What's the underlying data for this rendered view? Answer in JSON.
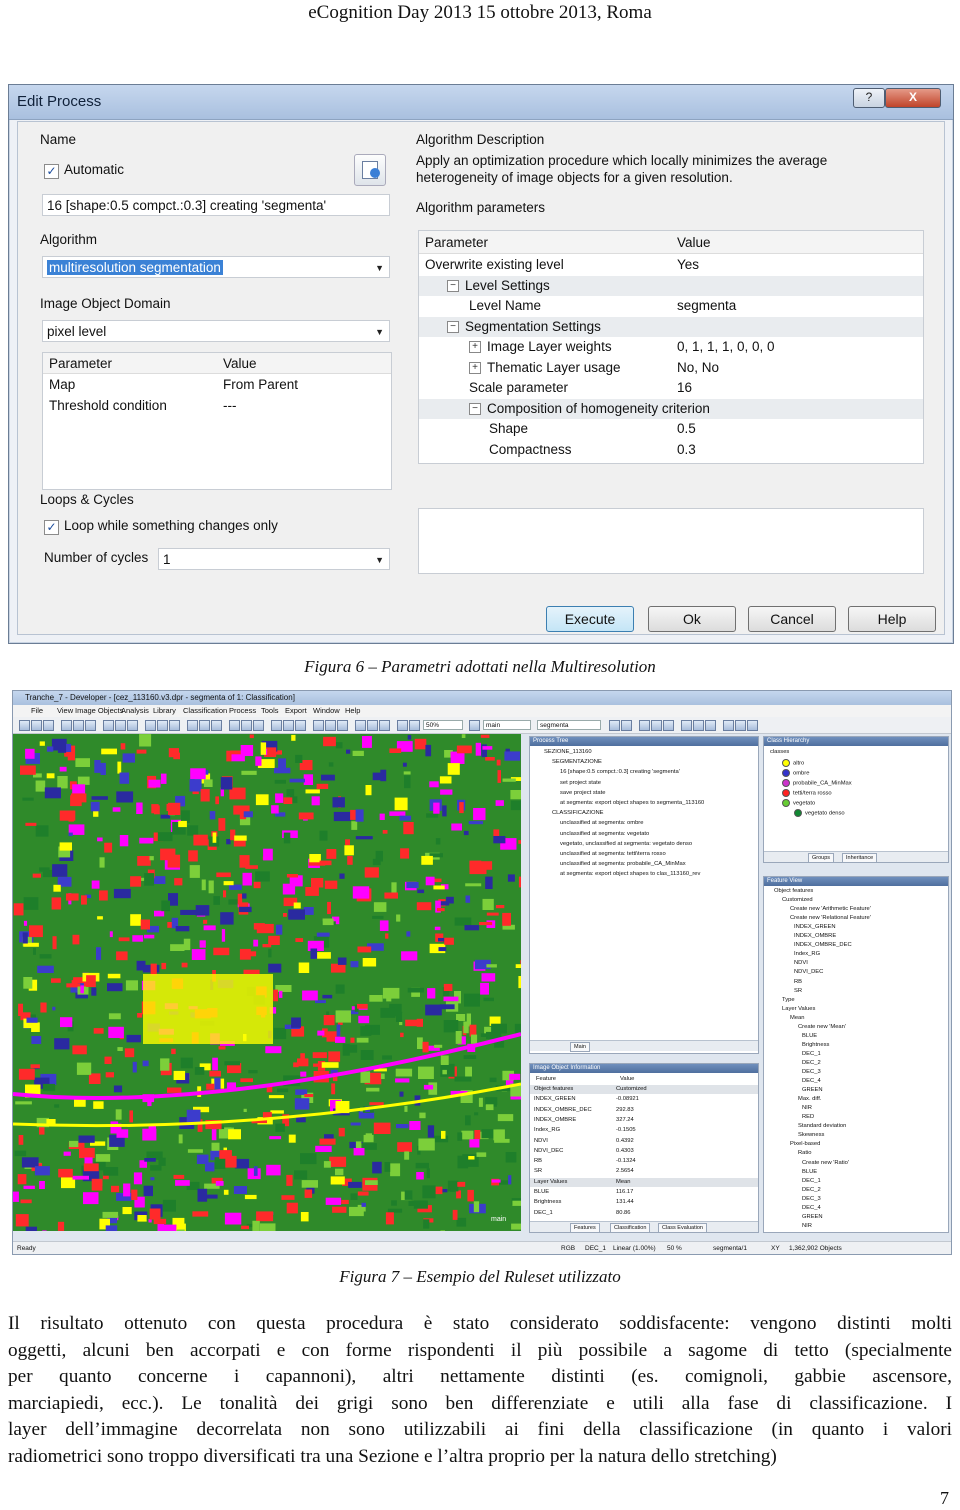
{
  "header": "eCognition Day 2013   15  ottobre 2013, Roma",
  "dialog": {
    "title": "Edit Process",
    "help_btn": "?",
    "close_btn": "X",
    "name_label": "Name",
    "automatic_label": "Automatic",
    "automatic_checked": true,
    "name_value": "16 [shape:0.5 compct.:0.3] creating 'segmenta'",
    "algorithm_label": "Algorithm",
    "algorithm_value": "multiresolution segmentation",
    "domain_label": "Image Object Domain",
    "domain_value": "pixel level",
    "domain_grid": {
      "headers": [
        "Parameter",
        "Value"
      ],
      "rows": [
        [
          "Map",
          "From Parent"
        ],
        [
          "Threshold condition",
          "---"
        ]
      ]
    },
    "loops_label": "Loops & Cycles",
    "loop_label": "Loop while something changes only",
    "loop_checked": true,
    "cycles_label": "Number of cycles",
    "cycles_value": "1",
    "desc_label": "Algorithm Description",
    "desc_text": "Apply an optimization procedure which locally minimizes the average heterogeneity of image objects for a given resolution.",
    "params_label": "Algorithm parameters",
    "params_headers": [
      "Parameter",
      "Value"
    ],
    "params": [
      {
        "name": "Overwrite existing level",
        "value": "Yes",
        "indent": 0,
        "exp": ""
      },
      {
        "name": "Level Settings",
        "value": "",
        "indent": 1,
        "exp": "−",
        "group": true
      },
      {
        "name": "Level Name",
        "value": "segmenta",
        "indent": 2,
        "exp": ""
      },
      {
        "name": "Segmentation Settings",
        "value": "",
        "indent": 1,
        "exp": "−",
        "group": true
      },
      {
        "name": "Image Layer weights",
        "value": "0, 1, 1, 1, 0, 0, 0",
        "indent": 2,
        "exp": "+"
      },
      {
        "name": "Thematic Layer usage",
        "value": "No, No",
        "indent": 2,
        "exp": "+"
      },
      {
        "name": "Scale parameter",
        "value": "16",
        "indent": 2,
        "exp": ""
      },
      {
        "name": "Composition of homogeneity criterion",
        "value": "",
        "indent": 2,
        "exp": "−",
        "group": true
      },
      {
        "name": "Shape",
        "value": "0.5",
        "indent": 3,
        "exp": ""
      },
      {
        "name": "Compactness",
        "value": "0.3",
        "indent": 3,
        "exp": ""
      }
    ],
    "buttons": {
      "execute": "Execute",
      "ok": "Ok",
      "cancel": "Cancel",
      "help": "Help"
    }
  },
  "caption6": "Figura 6 – Parametri adottati nella Multiresolution",
  "app": {
    "title": "Tranche_7 - Developer - [cez_113160.v3.dpr - segmenta of 1: Classification]",
    "menu": [
      "File",
      "View",
      "Image Objects",
      "Analysis",
      "Library",
      "Classification",
      "Process",
      "Tools",
      "Export",
      "Window",
      "Help"
    ],
    "zoom": "50%",
    "map_select": "main",
    "level_select": "segmenta",
    "map_label": "main",
    "process_tree": {
      "title": "Process Tree",
      "lines": [
        "SEZIONE_113160",
        "SEGMENTAZIONE",
        "16 [shape:0.5 compct.:0.3] creating 'segmenta'",
        "set project state",
        "save project state",
        "at segmenta: export object shapes to segmenta_113160",
        "CLASSIFICAZIONE",
        "unclassified at segmenta: ombre",
        "unclassified at segmenta: vegetato",
        "vegetato, unclassified at segmenta: vegetato denso",
        "unclassified at segmenta: tetti\\terra rosso",
        "unclassified at segmenta: probabile_CA_MinMax",
        "at segmenta: export object shapes to clas_113160_rev"
      ],
      "tab": "Main"
    },
    "class_hierarchy": {
      "title": "Class Hierarchy",
      "root": "classes",
      "items": [
        {
          "name": "altro",
          "color": "#ffff00"
        },
        {
          "name": "ombre",
          "color": "#3333cc"
        },
        {
          "name": "probabile_CA_MinMax",
          "color": "#cc33cc"
        },
        {
          "name": "tetti/terra rosso",
          "color": "#ff2222"
        },
        {
          "name": "vegetato",
          "color": "#66cc33"
        },
        {
          "name": "vegetato denso",
          "color": "#118833"
        }
      ],
      "tabs": [
        "Groups",
        "Inheritance"
      ]
    },
    "feature_view": {
      "title": "Feature View",
      "lines": [
        "Object features",
        "Customized",
        "Create new 'Arithmetic Feature'",
        "Create new 'Relational Feature'",
        "INDEX_GREEN",
        "INDEX_OMBRE",
        "INDEX_OMBRE_DEC",
        "Index_RG",
        "NDVI",
        "NDVI_DEC",
        "RB",
        "SR",
        "Type",
        "Layer Values",
        "Mean",
        "Create new 'Mean'",
        "BLUE",
        "Brightness",
        "DEC_1",
        "DEC_2",
        "DEC_3",
        "DEC_4",
        "GREEN",
        "Max. diff.",
        "NIR",
        "RED",
        "Standard deviation",
        "Skewness",
        "Pixel-based",
        "Ratio",
        "Create new 'Ratio'",
        "BLUE",
        "DEC_1",
        "DEC_2",
        "DEC_3",
        "DEC_4",
        "GREEN",
        "NIR"
      ]
    },
    "object_info": {
      "title": "Image Object Information",
      "headers": [
        "Feature",
        "Value"
      ],
      "rows": [
        [
          "Object features",
          "Customized"
        ],
        [
          "INDEX_GREEN",
          "-0.08921"
        ],
        [
          "INDEX_OMBRE_DEC",
          "292.83"
        ],
        [
          "INDEX_OMBRE",
          "327.24"
        ],
        [
          "Index_RG",
          "-0.1505"
        ],
        [
          "NDVI",
          "0.4392"
        ],
        [
          "NDVI_DEC",
          "0.4303"
        ],
        [
          "RB",
          "-0.1324"
        ],
        [
          "SR",
          "2.5654"
        ],
        [
          "Layer Values",
          "Mean"
        ],
        [
          "BLUE",
          "116.17"
        ],
        [
          "Brightness",
          "131.44"
        ],
        [
          "DEC_1",
          "80.86"
        ]
      ],
      "tabs": [
        "Features",
        "Classification",
        "Class Evaluation"
      ]
    },
    "status": {
      "ready": "Ready",
      "mode": "RGB",
      "layer": "DEC_1",
      "stretch": "Linear (1.00%)",
      "zoom": "50 %",
      "level": "segmenta/1",
      "xy": "XY",
      "objects": "1,362,902 Objects"
    }
  },
  "caption7": "Figura 7 – Esempio del Ruleset  utilizzato",
  "paragraph": [
    "Il risultato ottenuto con questa procedura è stato considerato soddisfacente: vengono distinti molti",
    "oggetti, alcuni ben accorpati e con forme rispondenti il più possibile a sagome di tetto (specialmente",
    "per quanto concerne i capannoni), altri nettamente distinti (es. comignoli, gabbie ascensore,",
    "marciapiedi, ecc.). Le tonalità dei grigi sono ben differenziate e utili alla fase di classificazione. I",
    "layer dell’immagine decorrelata non sono utilizzabili ai fini della classificazione (in quanto i valori",
    "radiometrici sono troppo diversificati tra una Sezione e l’altra proprio per la natura dello stretching)"
  ],
  "page_number": "7"
}
